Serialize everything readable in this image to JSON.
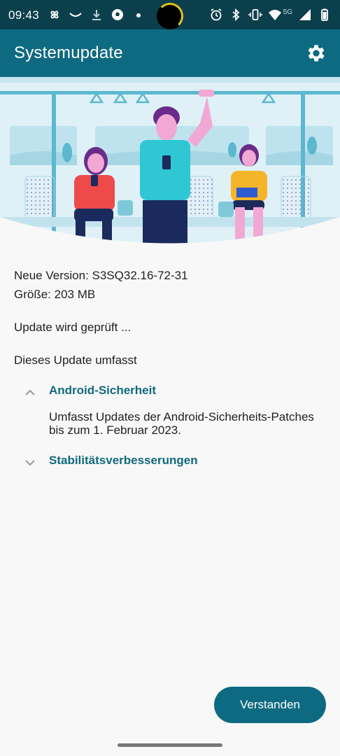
{
  "status_bar": {
    "time": "09:43",
    "network_label": "5G",
    "left_icons": [
      "pinwheel-icon",
      "smile-icon",
      "download-icon",
      "soccer-ball-icon",
      "dot-icon"
    ],
    "right_icons": [
      "alarm-icon",
      "bluetooth-icon",
      "vibrate-icon",
      "wifi-icon",
      "signal-icon",
      "battery-icon"
    ]
  },
  "app_bar": {
    "title": "Systemupdate",
    "settings_icon": "gear-icon"
  },
  "update_info": {
    "version_line": "Neue Version: S3SQ32.16-72-31",
    "size_line": "Größe: 203 MB",
    "status_line": "Update wird geprüft ...",
    "includes_heading": "Dieses Update umfasst"
  },
  "sections": [
    {
      "title": "Android-Sicherheit",
      "expanded": true,
      "body": "Umfasst Updates der Android-Sicherheits-Patches bis zum 1. Februar 2023."
    },
    {
      "title": "Stabilitätsverbesserungen",
      "expanded": false,
      "body": ""
    }
  ],
  "actions": {
    "confirm_label": "Verstanden"
  },
  "colors": {
    "status_bar_bg": "#0c3f4c",
    "app_bar_bg": "#0e6a80",
    "accent": "#11697e",
    "page_bg": "#f8f8f8"
  }
}
